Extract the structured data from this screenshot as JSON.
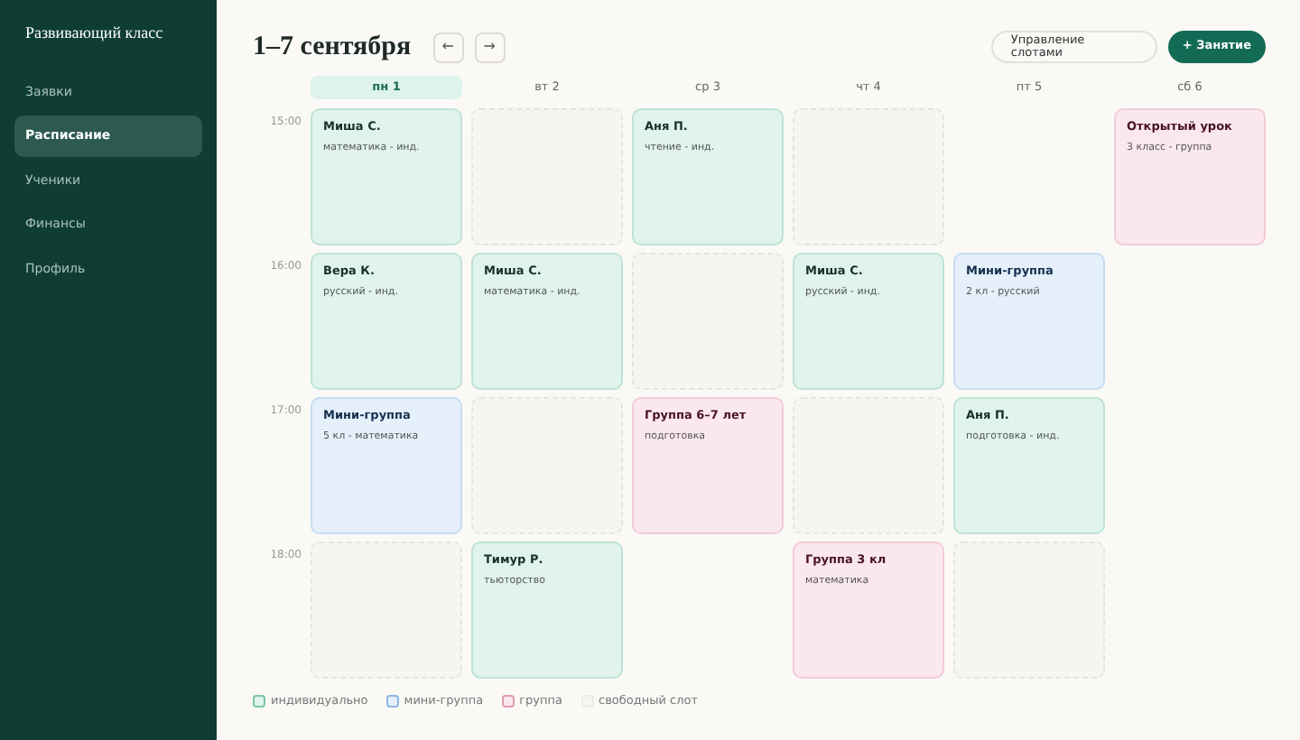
{
  "sidebar": {
    "title": "Развивающий класс",
    "items": [
      {
        "label": "Заявки",
        "selected": false
      },
      {
        "label": "Расписание",
        "selected": true
      },
      {
        "label": "Ученики",
        "selected": false
      },
      {
        "label": "Финансы",
        "selected": false
      },
      {
        "label": "Профиль",
        "selected": false
      }
    ]
  },
  "header": {
    "title": "1–7 сентября",
    "prev": "←",
    "next": "→",
    "manage_button": "Управление слотами",
    "add_button": "+ Занятие"
  },
  "days": [
    {
      "label": "пн 1",
      "selected": true
    },
    {
      "label": "вт 2",
      "selected": false
    },
    {
      "label": "ср 3",
      "selected": false
    },
    {
      "label": "чт 4",
      "selected": false
    },
    {
      "label": "пт 5",
      "selected": false
    },
    {
      "label": "сб 6",
      "selected": false
    }
  ],
  "rows": [
    {
      "time": "15:00",
      "cells": [
        {
          "kind": "individual",
          "title": "Миша С.",
          "subtitle": "математика - инд."
        },
        {
          "kind": "free"
        },
        {
          "kind": "individual",
          "title": "Аня П.",
          "subtitle": "чтение - инд."
        },
        {
          "kind": "free"
        },
        {
          "kind": "empty"
        },
        {
          "kind": "group",
          "title": "Открытый урок",
          "subtitle": "3 класс - группа"
        }
      ]
    },
    {
      "time": "16:00",
      "cells": [
        {
          "kind": "individual",
          "title": "Вера К.",
          "subtitle": "русский - инд."
        },
        {
          "kind": "individual",
          "title": "Миша С.",
          "subtitle": "математика - инд."
        },
        {
          "kind": "free"
        },
        {
          "kind": "individual",
          "title": "Миша С.",
          "subtitle": "русский - инд."
        },
        {
          "kind": "mini",
          "title": "Мини-группа",
          "subtitle": "2 кл - русский"
        },
        {
          "kind": "empty"
        }
      ]
    },
    {
      "time": "17:00",
      "cells": [
        {
          "kind": "mini",
          "title": "Мини-группа",
          "subtitle": "5 кл - математика"
        },
        {
          "kind": "free"
        },
        {
          "kind": "group",
          "title": "Группа 6–7 лет",
          "subtitle": "подготовка"
        },
        {
          "kind": "free"
        },
        {
          "kind": "individual",
          "title": "Аня П.",
          "subtitle": "подготовка - инд."
        },
        {
          "kind": "empty"
        }
      ]
    },
    {
      "time": "18:00",
      "cells": [
        {
          "kind": "free"
        },
        {
          "kind": "individual",
          "title": "Тимур Р.",
          "subtitle": "тьюторство"
        },
        {
          "kind": "empty"
        },
        {
          "kind": "group",
          "title": "Группа 3 кл",
          "subtitle": "математика"
        },
        {
          "kind": "free"
        },
        {
          "kind": "empty"
        }
      ]
    }
  ],
  "legend": [
    {
      "kind": "individual",
      "label": "индивидуально"
    },
    {
      "kind": "mini",
      "label": "мини-группа"
    },
    {
      "kind": "group",
      "label": "группа"
    },
    {
      "kind": "free",
      "label": "свободный слот"
    }
  ]
}
